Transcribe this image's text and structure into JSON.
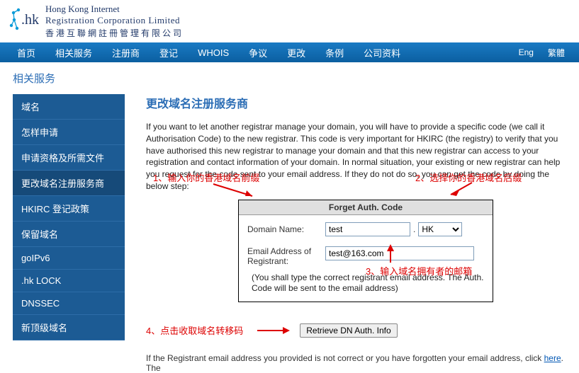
{
  "header": {
    "logo_en1": "Hong Kong Internet",
    "logo_en2": "Registration Corporation Limited",
    "logo_zh": "香港互聯網註冊管理有限公司"
  },
  "nav": {
    "items": [
      "首页",
      "相关服务",
      "注册商",
      "登记",
      "WHOIS",
      "争议",
      "更改",
      "条例",
      "公司资料"
    ],
    "lang": [
      "Eng",
      "繁體"
    ]
  },
  "page_sub": "相关服务",
  "sidebar": {
    "items": [
      "域名",
      "怎样申请",
      "申请资格及所需文件",
      "更改域名注册服务商",
      "HKIRC 登记政策",
      "保留域名",
      "goIPv6",
      ".hk LOCK",
      "DNSSEC",
      "新顶级域名"
    ]
  },
  "main": {
    "title": "更改域名注册服务商",
    "para": "If you want to let another registrar manage your domain, you will have to provide a specific code (we call it Authorisation Code) to the new registrar. This code is very important for HKIRC (the registry) to verify that you have authorised this new registrar to manage your domain and that this new registrar can access to your registration and contact information of your domain. In normal situation, your existing or new registrar can help you request for the code sent to your email address. If they do not do so, you can get the code by doing the below step:",
    "annot1": "1、输入你的香港域名前缀",
    "annot2": "2、选择你的香港域名后缀",
    "annot3": "3、输入域名拥有者的邮箱",
    "annot4": "4、点击收取域名转移码",
    "form": {
      "title": "Forget Auth. Code",
      "domain_label": "Domain Name:",
      "domain_value": "test",
      "suffix_value": "HK",
      "email_label1": "Email Address of",
      "email_label2": "Registrant:",
      "email_value": "test@163.com",
      "note": "(You shall type the correct registrant email address. The Auth. Code will be sent to the email address)"
    },
    "retrieve_btn": "Retrieve DN Auth. Info",
    "footer_pre": "If the Registrant email address you provided is not correct or you have forgotten your email address, click ",
    "footer_link": "here",
    "footer_post": ". The"
  }
}
